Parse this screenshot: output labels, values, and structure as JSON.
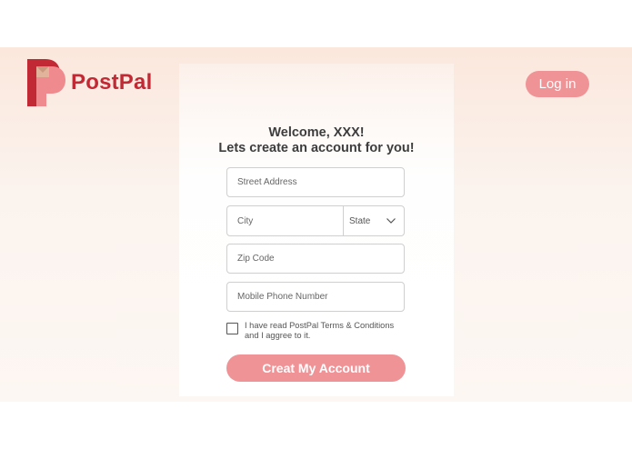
{
  "header": {
    "brand_name": "PostPal",
    "login_label": "Log in"
  },
  "form": {
    "title_line1": "Welcome, XXX!",
    "title_line2": "Lets create an account for you!",
    "street_placeholder": "Street Address",
    "city_placeholder": "City",
    "state_label": "State",
    "zip_placeholder": "Zip Code",
    "phone_placeholder": "Mobile Phone Number",
    "terms_text_line1": "I have read PostPal Terms & Conditions",
    "terms_text_line2": "and I aggree to it.",
    "terms_checked": false,
    "submit_label": "Creat My Account"
  },
  "colors": {
    "brand_red": "#c12a35",
    "button_pink": "#f09396",
    "background_peach": "#fbe7dc"
  },
  "icons": {
    "logo": "postpal-logo-icon",
    "state_dropdown": "chevron-down-icon"
  }
}
